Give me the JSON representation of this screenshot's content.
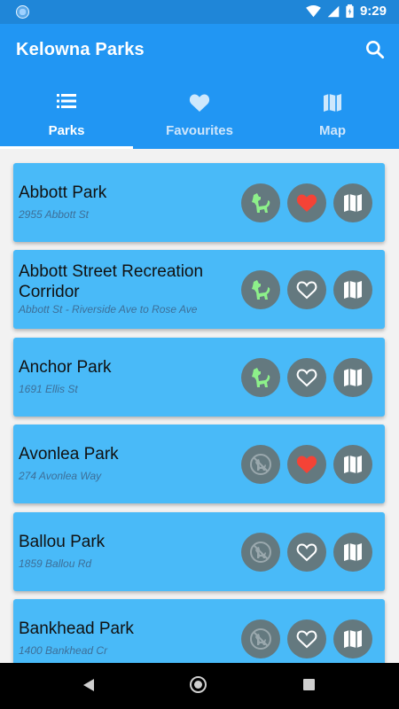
{
  "status": {
    "time": "9:29"
  },
  "app": {
    "title": "Kelowna Parks"
  },
  "tabs": [
    {
      "label": "Parks",
      "icon": "list-icon",
      "active": true
    },
    {
      "label": "Favourites",
      "icon": "heart-icon",
      "active": false
    },
    {
      "label": "Map",
      "icon": "map-icon",
      "active": false
    }
  ],
  "parks": [
    {
      "name": "Abbott Park",
      "address": "2955 Abbott St",
      "dogs_allowed": true,
      "favourite": true
    },
    {
      "name": "Abbott Street Recreation Corridor",
      "address": "Abbott St - Riverside Ave to Rose Ave",
      "dogs_allowed": true,
      "favourite": false
    },
    {
      "name": "Anchor Park",
      "address": "1691 Ellis St",
      "dogs_allowed": true,
      "favourite": false
    },
    {
      "name": "Avonlea Park",
      "address": "274 Avonlea Way",
      "dogs_allowed": false,
      "favourite": true
    },
    {
      "name": "Ballou Park",
      "address": "1859 Ballou Rd",
      "dogs_allowed": false,
      "favourite": false
    },
    {
      "name": "Bankhead Park",
      "address": "1400 Bankhead Cr",
      "dogs_allowed": false,
      "favourite": false
    }
  ],
  "colors": {
    "primary": "#2196f3",
    "card": "#49baf8",
    "button": "#64797f",
    "dog_allowed": "#8df08a",
    "favourite": "#f44336"
  }
}
